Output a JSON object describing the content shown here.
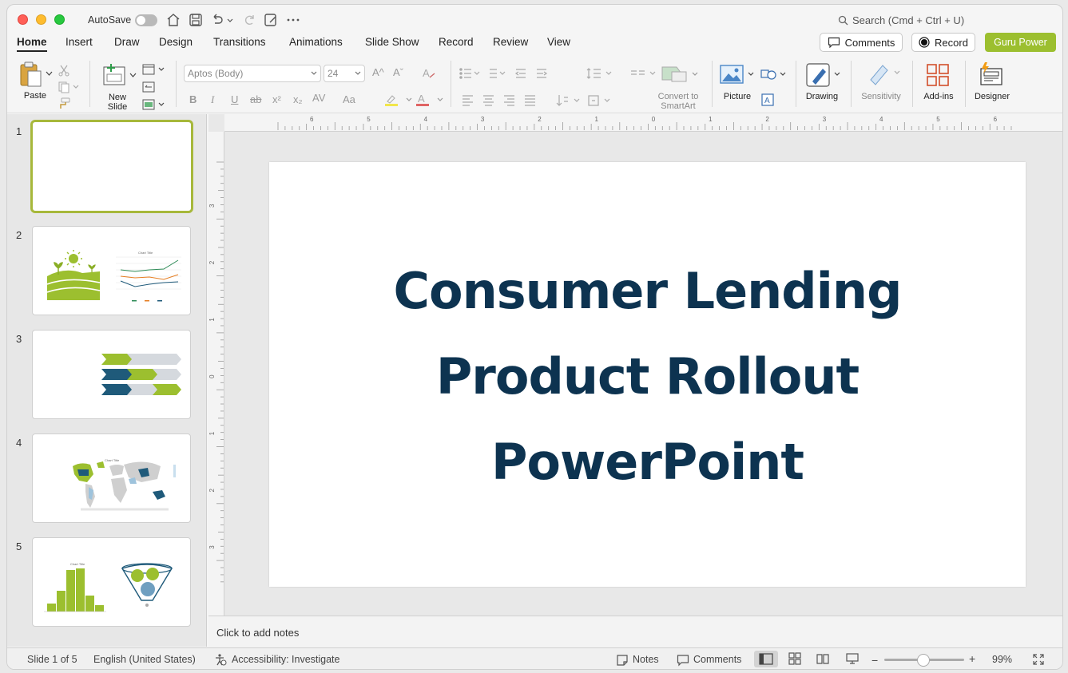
{
  "titlebar": {
    "autosave_label": "AutoSave",
    "search_placeholder": "Search (Cmd + Ctrl + U)"
  },
  "menu": {
    "tabs": [
      "Home",
      "Insert",
      "Draw",
      "Design",
      "Transitions",
      "Animations",
      "Slide Show",
      "Record",
      "Review",
      "View"
    ],
    "active_tab": "Home",
    "comments_label": "Comments",
    "record_label": "Record",
    "guru_label": "Guru Power"
  },
  "ribbon": {
    "paste_label": "Paste",
    "new_slide_label": "New\nSlide",
    "font_name": "Aptos (Body)",
    "font_size": "24",
    "convert_label": "Convert to\nSmartArt",
    "picture_label": "Picture",
    "drawing_label": "Drawing",
    "sensitivity_label": "Sensitivity",
    "addins_label": "Add-ins",
    "designer_label": "Designer",
    "bold": "B",
    "italic": "I",
    "underline": "U",
    "strike": "ab",
    "superscript": "x²",
    "subscript": "x₂",
    "spacing": "AV",
    "case": "Aa",
    "font_grow": "A^",
    "font_shrink": "Aˇ"
  },
  "slides": [
    {
      "number": "1"
    },
    {
      "number": "2"
    },
    {
      "number": "3"
    },
    {
      "number": "4"
    },
    {
      "number": "5"
    }
  ],
  "thumb2": {
    "chart_title": "Chart Title"
  },
  "thumb4": {
    "chart_title": "Chart Title"
  },
  "thumb5": {
    "chart_title": "Chart Title"
  },
  "ruler": {
    "h_ticks": [
      "6",
      "5",
      "4",
      "3",
      "2",
      "1",
      "0",
      "1",
      "2",
      "3",
      "4",
      "5",
      "6"
    ],
    "v_ticks": [
      "3",
      "2",
      "1",
      "0",
      "1",
      "2",
      "3"
    ]
  },
  "current_slide": {
    "title_lines": [
      "Consumer Lending",
      "Product Rollout",
      "PowerPoint"
    ]
  },
  "notes": {
    "placeholder": "Click to add notes"
  },
  "status": {
    "slide_indicator": "Slide 1 of 5",
    "language": "English (United States)",
    "accessibility": "Accessibility: Investigate",
    "notes_label": "Notes",
    "comments_label": "Comments",
    "zoom_minus": "−",
    "zoom_plus": "+",
    "zoom_level": "99%"
  },
  "colors": {
    "title": "#0d3350",
    "accent_green": "#9cbf2f",
    "dark_blue": "#1f5a7a",
    "selection": "#a7b83b"
  }
}
